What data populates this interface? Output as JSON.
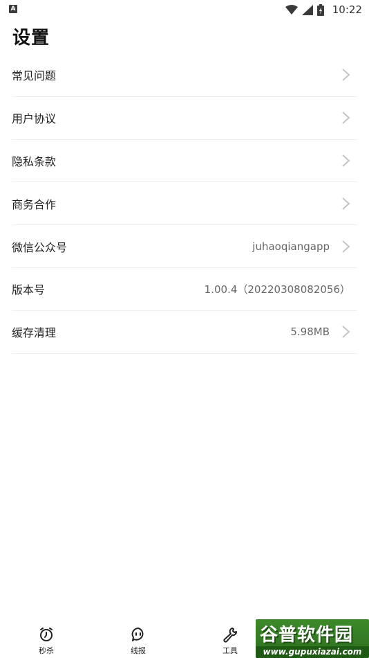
{
  "status_bar": {
    "notification_badge": "A",
    "time": "10:22",
    "icons": [
      "wifi-icon",
      "cellular-signal-icon",
      "battery-charging-icon"
    ]
  },
  "page": {
    "title": "设置"
  },
  "settings": [
    {
      "label": "常见问题",
      "value": "",
      "chevron": true
    },
    {
      "label": "用户协议",
      "value": "",
      "chevron": true
    },
    {
      "label": "隐私条款",
      "value": "",
      "chevron": true
    },
    {
      "label": "商务合作",
      "value": "",
      "chevron": true
    },
    {
      "label": "微信公众号",
      "value": "juhaoqiangapp",
      "chevron": true
    },
    {
      "label": "版本号",
      "value": "1.00.4（20220308082056）",
      "chevron": false
    },
    {
      "label": "缓存清理",
      "value": "5.98MB",
      "chevron": true
    }
  ],
  "tabbar": {
    "tabs": [
      {
        "label": "秒杀",
        "icon": "alarm-clock-icon"
      },
      {
        "label": "线报",
        "icon": "chat-bubble-icon"
      },
      {
        "label": "工具",
        "icon": "wrench-icon"
      }
    ]
  },
  "watermark": {
    "main": "谷普软件园",
    "sub": "www.gupuxiazai.com"
  },
  "colors": {
    "chevron": "#c4c4c4",
    "divider": "#efefef",
    "watermark_green": "#3d8a2a"
  }
}
